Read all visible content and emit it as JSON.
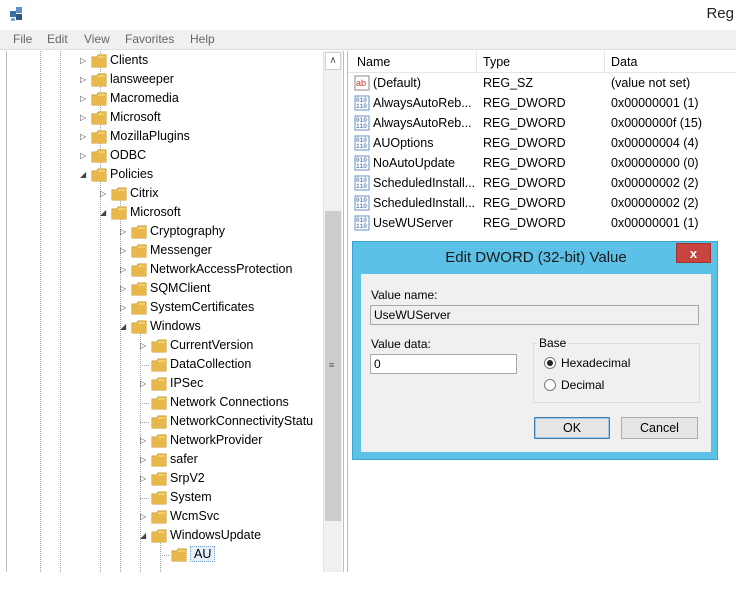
{
  "window": {
    "title": "Reg"
  },
  "menu": [
    "File",
    "Edit",
    "View",
    "Favorites",
    "Help"
  ],
  "tree": [
    {
      "label": "Clients",
      "expander": "▷"
    },
    {
      "label": "lansweeper",
      "expander": "▷"
    },
    {
      "label": "Macromedia",
      "expander": "▷"
    },
    {
      "label": "Microsoft",
      "expander": "▷"
    },
    {
      "label": "MozillaPlugins",
      "expander": "▷"
    },
    {
      "label": "ODBC",
      "expander": "▷"
    },
    {
      "label": "Policies",
      "expander": "◢"
    },
    {
      "label": "Citrix",
      "expander": "▷"
    },
    {
      "label": "Microsoft",
      "expander": "◢"
    },
    {
      "label": "Cryptography",
      "expander": "▷"
    },
    {
      "label": "Messenger",
      "expander": "▷"
    },
    {
      "label": "NetworkAccessProtection",
      "expander": "▷"
    },
    {
      "label": "SQMClient",
      "expander": "▷"
    },
    {
      "label": "SystemCertificates",
      "expander": "▷"
    },
    {
      "label": "Windows",
      "expander": "◢"
    },
    {
      "label": "CurrentVersion",
      "expander": "▷"
    },
    {
      "label": "DataCollection",
      "expander": ""
    },
    {
      "label": "IPSec",
      "expander": "▷"
    },
    {
      "label": "Network Connections",
      "expander": ""
    },
    {
      "label": "NetworkConnectivityStatu",
      "expander": ""
    },
    {
      "label": "NetworkProvider",
      "expander": "▷"
    },
    {
      "label": "safer",
      "expander": "▷"
    },
    {
      "label": "SrpV2",
      "expander": "▷"
    },
    {
      "label": "System",
      "expander": ""
    },
    {
      "label": "WcmSvc",
      "expander": "▷"
    },
    {
      "label": "WindowsUpdate",
      "expander": "◢"
    },
    {
      "label": "AU",
      "expander": ""
    }
  ],
  "list": {
    "headers": {
      "name": "Name",
      "type": "Type",
      "data": "Data"
    },
    "rows": [
      {
        "icon": "string-value-icon",
        "name": "(Default)",
        "type": "REG_SZ",
        "data": "(value not set)"
      },
      {
        "icon": "binary-value-icon",
        "name": "AlwaysAutoReb...",
        "type": "REG_DWORD",
        "data": "0x00000001 (1)"
      },
      {
        "icon": "binary-value-icon",
        "name": "AlwaysAutoReb...",
        "type": "REG_DWORD",
        "data": "0x0000000f (15)"
      },
      {
        "icon": "binary-value-icon",
        "name": "AUOptions",
        "type": "REG_DWORD",
        "data": "0x00000004 (4)"
      },
      {
        "icon": "binary-value-icon",
        "name": "NoAutoUpdate",
        "type": "REG_DWORD",
        "data": "0x00000000 (0)"
      },
      {
        "icon": "binary-value-icon",
        "name": "ScheduledInstall...",
        "type": "REG_DWORD",
        "data": "0x00000002 (2)"
      },
      {
        "icon": "binary-value-icon",
        "name": "ScheduledInstall...",
        "type": "REG_DWORD",
        "data": "0x00000002 (2)"
      },
      {
        "icon": "binary-value-icon",
        "name": "UseWUServer",
        "type": "REG_DWORD",
        "data": "0x00000001 (1)"
      }
    ]
  },
  "dialog": {
    "title": "Edit DWORD (32-bit) Value",
    "close": "x",
    "value_name_label": "Value name:",
    "value_name": "UseWUServer",
    "value_data_label": "Value data:",
    "value_data": "0",
    "base_label": "Base",
    "hex_label": "Hexadecimal",
    "dec_label": "Decimal",
    "selected_base": "Hexadecimal",
    "ok": "OK",
    "cancel": "Cancel"
  },
  "colors": {
    "dialog_frame": "#5bc1e6",
    "close_button": "#c7453e",
    "folder": "#e8b84a"
  }
}
